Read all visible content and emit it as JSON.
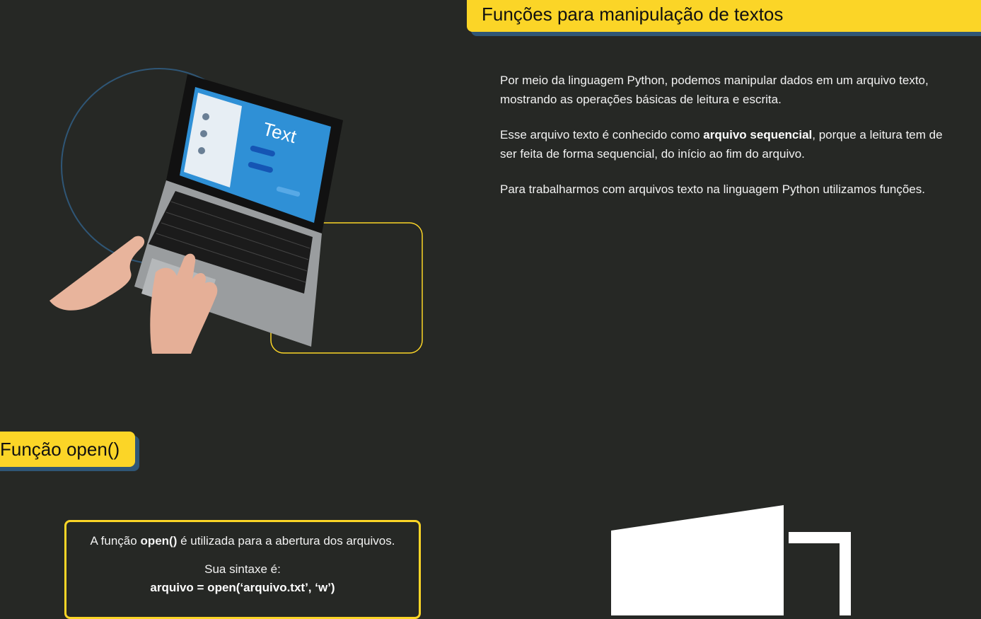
{
  "section1": {
    "title": "Funções para manipulação de textos",
    "paragraph1": "Por meio da linguagem Python, podemos manipular dados em um arquivo texto, mostrando as operações básicas de leitura e escrita.",
    "paragraph2_before": "Esse arquivo texto é conhecido como ",
    "paragraph2_bold": "arquivo sequencial",
    "paragraph2_after": ", porque a leitura tem de ser feita de forma sequencial, do início ao fim do arquivo.",
    "paragraph3": "Para trabalharmos com arquivos texto na linguagem Python utilizamos funções.",
    "screen_text": "Text"
  },
  "section2": {
    "title": "Função open()",
    "line1_before": "A função ",
    "line1_bold": "open()",
    "line1_after": " é utilizada para a abertura dos arquivos.",
    "line2": "Sua sintaxe é:",
    "code": "arquivo = open(‘arquivo.txt’, ‘w’)"
  },
  "colors": {
    "background": "#262825",
    "accent": "#fbd527",
    "shadow": "#2f5676"
  }
}
